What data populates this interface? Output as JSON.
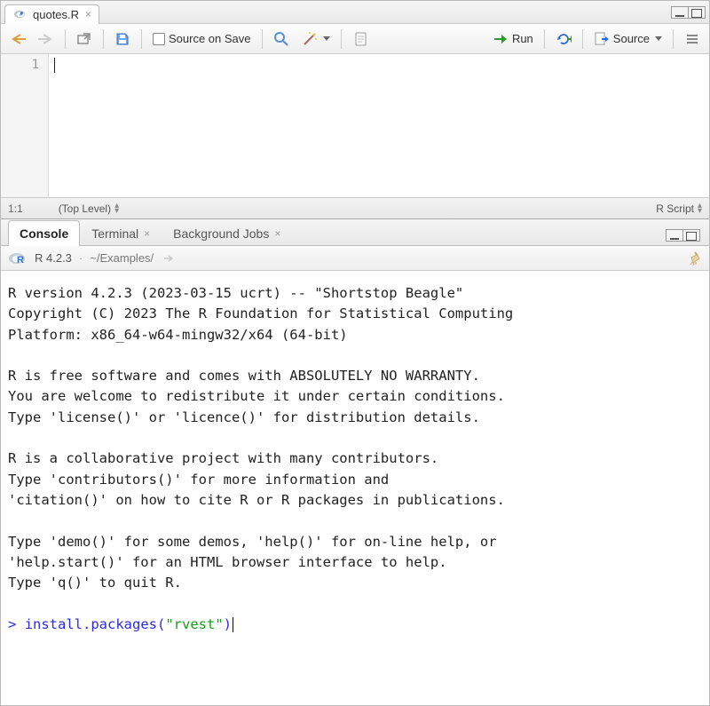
{
  "editor": {
    "tab_filename": "quotes.R",
    "source_on_save_label": "Source on Save",
    "run_label": "Run",
    "source_label": "Source",
    "gutter_line": "1",
    "status_pos": "1:1",
    "status_scope": "(Top Level)",
    "status_lang": "R Script"
  },
  "console": {
    "tabs": {
      "console": "Console",
      "terminal": "Terminal",
      "background_jobs": "Background Jobs"
    },
    "r_version_short": "R 4.2.3",
    "working_dir": "~/Examples/",
    "banner": "R version 4.2.3 (2023-03-15 ucrt) -- \"Shortstop Beagle\"\nCopyright (C) 2023 The R Foundation for Statistical Computing\nPlatform: x86_64-w64-mingw32/x64 (64-bit)\n\nR is free software and comes with ABSOLUTELY NO WARRANTY.\nYou are welcome to redistribute it under certain conditions.\nType 'license()' or 'licence()' for distribution details.\n\nR is a collaborative project with many contributors.\nType 'contributors()' for more information and\n'citation()' on how to cite R or R packages in publications.\n\nType 'demo()' for some demos, 'help()' for on-line help, or\n'help.start()' for an HTML browser interface to help.\nType 'q()' to quit R.\n",
    "prompt_char": ">",
    "input_fn": "install.packages",
    "input_arg": "\"rvest\""
  }
}
